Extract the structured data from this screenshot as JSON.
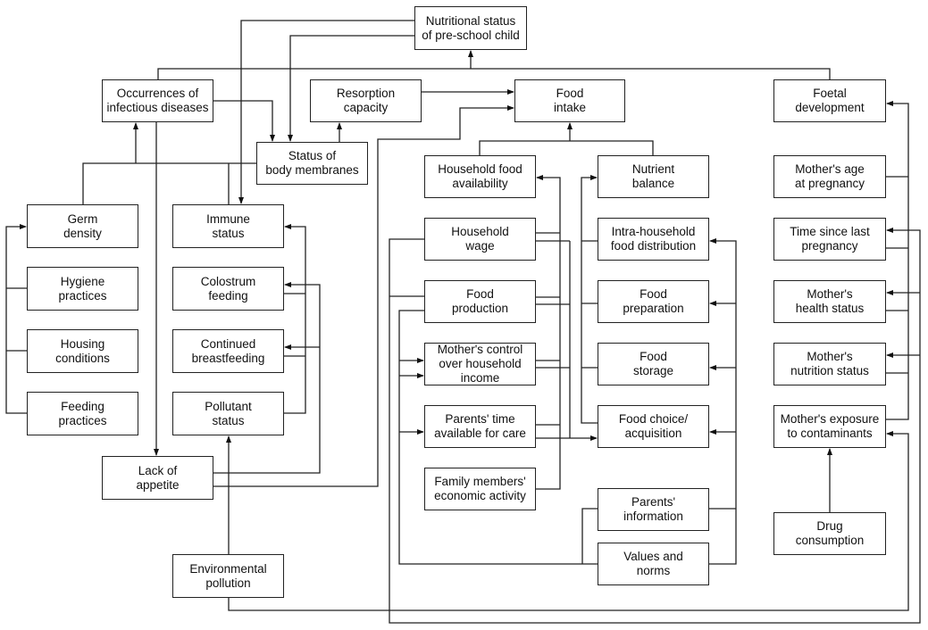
{
  "nodes": {
    "nutritional_status": "Nutritional status\nof pre-school child",
    "infectious_diseases": "Occurrences of\ninfectious diseases",
    "resorption": "Resorption\ncapacity",
    "food_intake": "Food\nintake",
    "foetal_development": "Foetal\ndevelopment",
    "body_membranes": "Status of\nbody membranes",
    "germ_density": "Germ\ndensity",
    "immune_status": "Immune\nstatus",
    "hygiene": "Hygiene\npractices",
    "colostrum": "Colostrum\nfeeding",
    "housing": "Housing\nconditions",
    "breastfeeding": "Continued\nbreastfeeding",
    "feeding_practices": "Feeding\npractices",
    "pollutant_status": "Pollutant\nstatus",
    "lack_of_appetite": "Lack of\nappetite",
    "environmental_pollution": "Environmental\npollution",
    "household_food": "Household food\navailability",
    "nutrient_balance": "Nutrient\nbalance",
    "household_wage": "Household\nwage",
    "intra_household": "Intra-household\nfood distribution",
    "food_production": "Food\nproduction",
    "food_preparation": "Food\npreparation",
    "mothers_control": "Mother's control\nover household\nincome",
    "food_storage": "Food\nstorage",
    "parents_time": "Parents' time\navailable for care",
    "food_choice": "Food choice/\nacquisition",
    "family_economic": "Family members'\neconomic activity",
    "parents_information": "Parents'\ninformation",
    "values_norms": "Values and\nnorms",
    "mothers_age": "Mother's age\nat pregnancy",
    "time_since_pregnancy": "Time since last\npregnancy",
    "mothers_health": "Mother's\nhealth status",
    "mothers_nutrition": "Mother's\nnutrition status",
    "mothers_exposure": "Mother's exposure\nto contaminants",
    "drug_consumption": "Drug\nconsumption"
  }
}
